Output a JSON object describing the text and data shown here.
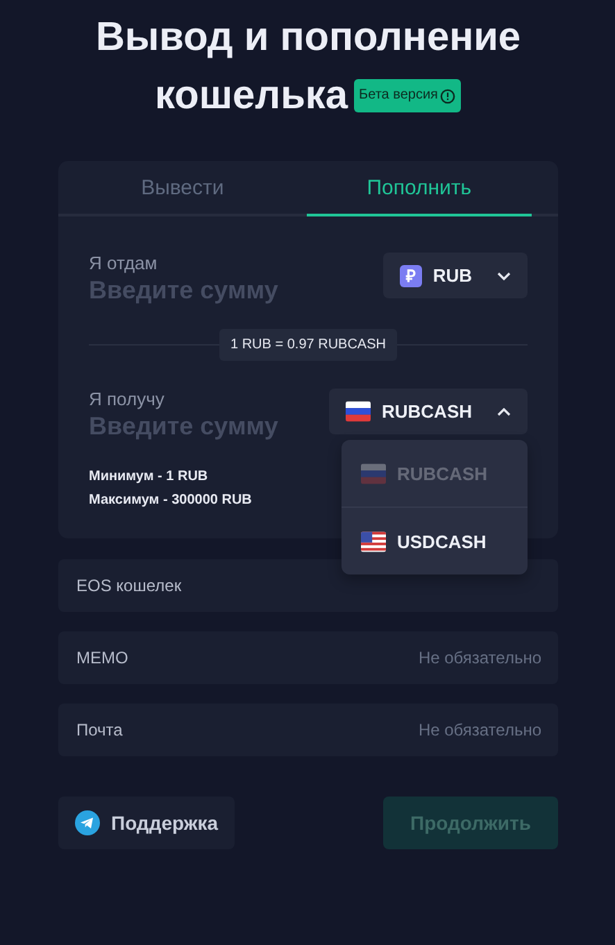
{
  "title_lines": [
    "Вывод и пополнение",
    "кошелька"
  ],
  "badge": "Бета версия",
  "tabs": [
    {
      "label": "Вывести",
      "selected": false
    },
    {
      "label": "Пополнить",
      "selected": true
    }
  ],
  "give": {
    "label": "Я отдам",
    "placeholder": "Введите сумму",
    "currency": {
      "kind": "symbol",
      "symbol": "₽",
      "code": "RUB"
    },
    "expanded": false
  },
  "rate": "1 RUB = 0.97 RUBCASH",
  "receive": {
    "label": "Я получу",
    "placeholder": "Введите сумму",
    "currency": {
      "kind": "flag-ru",
      "code": "RUBCASH"
    },
    "expanded": true,
    "options": [
      {
        "kind": "flag-ru",
        "code": "RUBCASH",
        "selected": true
      },
      {
        "kind": "flag-us",
        "code": "USDCASH",
        "selected": false
      }
    ]
  },
  "limits": [
    "Минимум - 1 RUB",
    "Максимум - 300000 RUB"
  ],
  "fields": [
    {
      "label": "EOS кошелек"
    },
    {
      "label": "MEMO",
      "placeholder": "Не обязательно"
    },
    {
      "label": "Почта",
      "placeholder": "Не обязательно"
    }
  ],
  "support_button": "Поддержка",
  "continue_button": {
    "label": "Продолжить",
    "disabled": true
  }
}
